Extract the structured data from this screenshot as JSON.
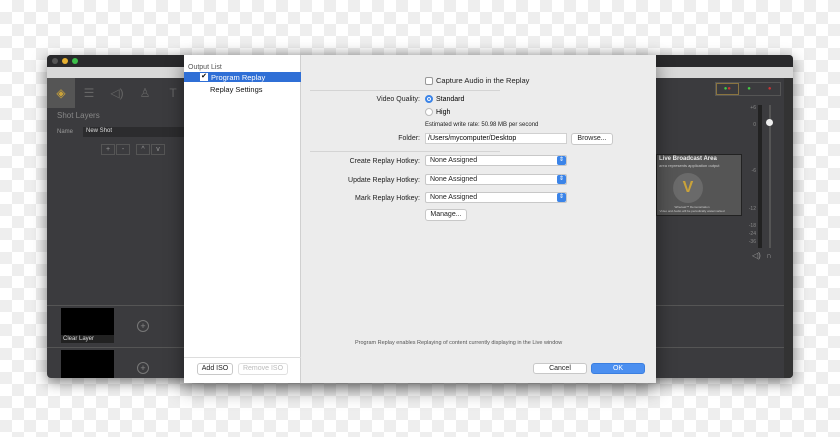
{
  "app": {
    "shot_layers_title": "Shot Layers",
    "name_label": "Name",
    "name_value": "New Shot",
    "layer_buttons": [
      "+",
      "-",
      "^",
      "v"
    ],
    "clear_layer_label": "Clear Layer",
    "toolbar_icons": [
      "layers-icon",
      "sliders-icon",
      "speaker-icon",
      "person-icon",
      "title-icon"
    ],
    "broadcast": {
      "title": "Live Broadcast Area",
      "subtitle": "area represents application output",
      "footer1": "Wirecast™ Demonstration",
      "footer2": "Video and Audio will be periodically watermarked"
    },
    "meter_ticks": [
      "+6",
      "0",
      "-6",
      "-12",
      "-18",
      "-24",
      "-36"
    ],
    "volume_level": 0.9
  },
  "dialog": {
    "sidebar": {
      "header": "Output List",
      "items": [
        {
          "label": "Program Replay",
          "checked": true,
          "selected": true
        },
        {
          "label": "Replay Settings"
        }
      ],
      "add_iso": "Add ISO",
      "remove_iso": "Remove ISO"
    },
    "capture_audio": {
      "label": "Capture Audio in the Replay",
      "checked": false
    },
    "video_quality": {
      "label": "Video Quality:",
      "options": [
        "Standard",
        "High"
      ],
      "selected": "Standard"
    },
    "write_rate": "Estimated write rate: 50.98 MB per second",
    "folder": {
      "label": "Folder:",
      "value": "/Users/mycomputer/Desktop",
      "browse": "Browse..."
    },
    "hotkeys": [
      {
        "label": "Create Replay Hotkey:",
        "value": "None Assigned"
      },
      {
        "label": "Update Replay Hotkey:",
        "value": "None Assigned"
      },
      {
        "label": "Mark Replay Hotkey:",
        "value": "None Assigned"
      }
    ],
    "manage": "Manage...",
    "info": "Program Replay enables Replaying of content currently displaying in the Live window",
    "cancel": "Cancel",
    "ok": "OK"
  },
  "colors": {
    "accent": "#3b84e8",
    "app_bg": "#3b3b3e"
  }
}
